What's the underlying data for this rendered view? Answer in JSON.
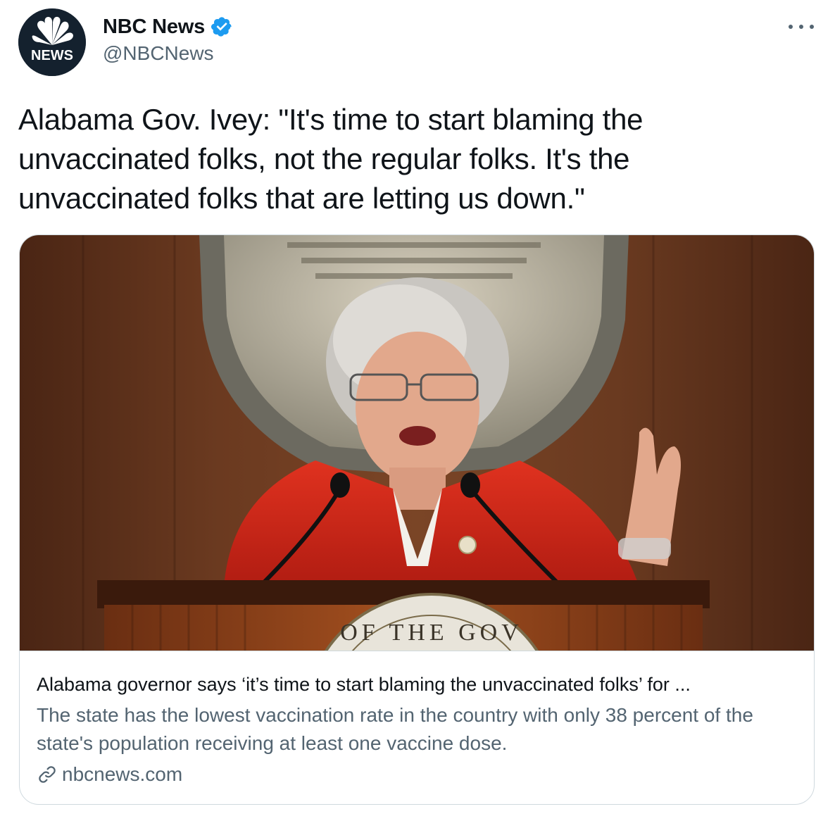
{
  "author": {
    "display_name": "NBC News",
    "handle": "@NBCNews",
    "verified": true,
    "avatar_icon": "nbc-peacock-logo",
    "avatar_label": "NEWS"
  },
  "menu": {
    "more_icon": "more-horizontal-icon"
  },
  "tweet": {
    "text": "Alabama Gov. Ivey: \"It's time to start blaming the unvaccinated folks, not the regular folks. It's the unvaccinated folks that are letting us down.\""
  },
  "card": {
    "image_icon": "article-photo",
    "podium_text": "OF THE GOV",
    "title": "Alabama governor says ‘it’s time to start blaming the unvaccinated folks’ for ...",
    "description": "The state has the lowest vaccination rate in the country with only 38 percent of the state's population receiving at least one vaccine dose.",
    "domain": "nbcnews.com",
    "domain_icon": "link-icon"
  },
  "colors": {
    "text_primary": "#0f1419",
    "text_secondary": "#536471",
    "verified_blue": "#1d9bf0",
    "border": "#cfd9de"
  }
}
